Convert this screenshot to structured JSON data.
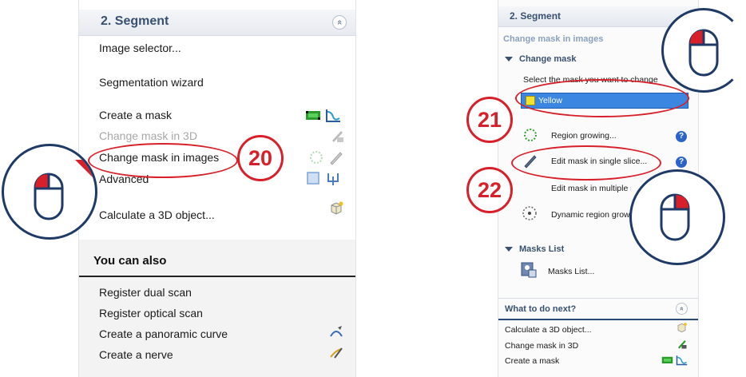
{
  "left_panel": {
    "header_title": "2. Segment",
    "collapse_glyph": "«",
    "items": [
      {
        "label": "Image selector..."
      },
      {
        "label": "Segmentation wizard"
      },
      {
        "label": "Create a mask"
      },
      {
        "label": "Change mask in 3D"
      },
      {
        "label": "Change mask in images"
      },
      {
        "label": "Advanced"
      },
      {
        "label": "Calculate a 3D object..."
      }
    ],
    "also_title": "You can also",
    "also_items": [
      {
        "label": "Register dual scan"
      },
      {
        "label": "Register optical scan"
      },
      {
        "label": "Create a panoramic curve"
      },
      {
        "label": "Create a nerve"
      }
    ]
  },
  "right_panel": {
    "header_title": "2. Segment",
    "collapse_glyph": "«",
    "subtitle": "Change mask in images",
    "change_mask_group": "Change mask",
    "select_prompt": "Select the mask you want to change",
    "selected_mask": "Yellow",
    "tools": [
      {
        "label": "Region growing..."
      },
      {
        "label": "Edit mask in single slice..."
      },
      {
        "label": "Edit mask in multiple slices..."
      },
      {
        "label": "Dynamic region growing..."
      }
    ],
    "masks_group": "Masks List",
    "masks_item": "Masks List...",
    "next_title": "What to do next?",
    "next_glyph": "«",
    "next_items": [
      {
        "label": "Calculate a 3D object..."
      },
      {
        "label": "Change mask in 3D"
      },
      {
        "label": "Create a mask"
      }
    ],
    "help_glyph": "?"
  },
  "callouts": {
    "badge_20": "20",
    "badge_21": "21",
    "badge_22": "22"
  },
  "colors": {
    "accent_red": "#d8202a",
    "navy": "#1f3a66",
    "header_text": "#39506e",
    "selection_blue": "#3a86e0"
  }
}
